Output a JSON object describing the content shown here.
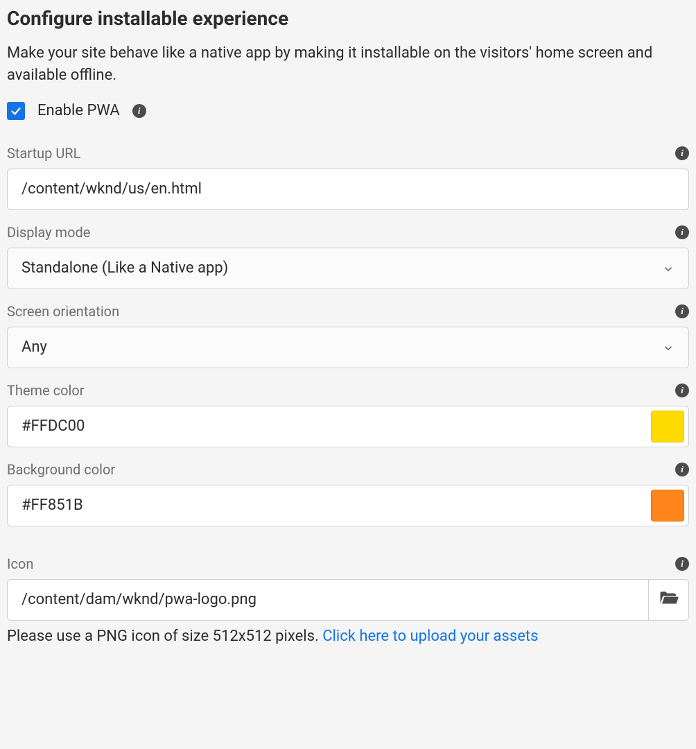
{
  "header": {
    "title": "Configure installable experience",
    "description": "Make your site behave like a native app by making it installable on the visitors' home screen and available offline."
  },
  "enable": {
    "label": "Enable PWA",
    "checked": true
  },
  "startup_url": {
    "label": "Startup URL",
    "value": "/content/wknd/us/en.html"
  },
  "display_mode": {
    "label": "Display mode",
    "value": "Standalone (Like a Native app)"
  },
  "screen_orientation": {
    "label": "Screen orientation",
    "value": "Any"
  },
  "theme_color": {
    "label": "Theme color",
    "value": "#FFDC00"
  },
  "background_color": {
    "label": "Background color",
    "value": "#FF851B"
  },
  "icon": {
    "label": "Icon",
    "value": "/content/dam/wknd/pwa-logo.png",
    "hint_text": "Please use a PNG icon of size 512x512 pixels. ",
    "hint_link": "Click here to upload your assets"
  }
}
